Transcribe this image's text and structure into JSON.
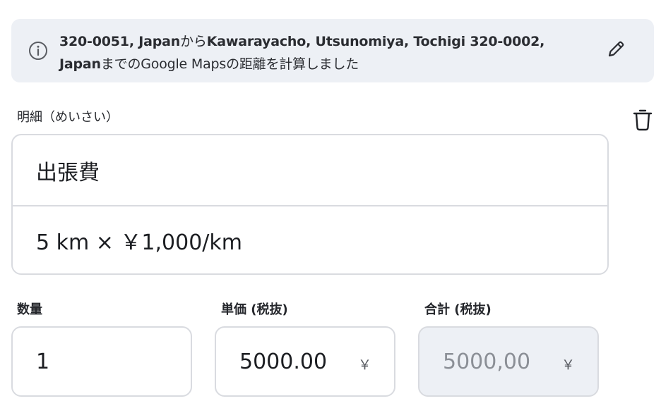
{
  "info": {
    "part1": "320-0051, Japan",
    "part2": "から",
    "part3": "Kawarayacho, Utsunomiya, Tochigi 320-0002, Japan",
    "part4": "までのGoogle Mapsの距離を計算しました",
    "icon": "info-icon",
    "edit_icon": "pencil-icon"
  },
  "item": {
    "label": "明細（めいさい）",
    "title_value": "出張費",
    "detail_value": "5 km × ￥1,000/km",
    "delete_icon": "trash-icon"
  },
  "quantity": {
    "label": "数量",
    "value": "1"
  },
  "unit_price": {
    "label": "単価 (税抜)",
    "value": "5000.00",
    "currency": "￥"
  },
  "total": {
    "label": "合計 (税抜)",
    "value": "5000,00",
    "currency": "￥"
  },
  "colors": {
    "banner_bg": "#edf0f5",
    "border": "#d9dbe0",
    "disabled_text": "#8b8f96"
  }
}
